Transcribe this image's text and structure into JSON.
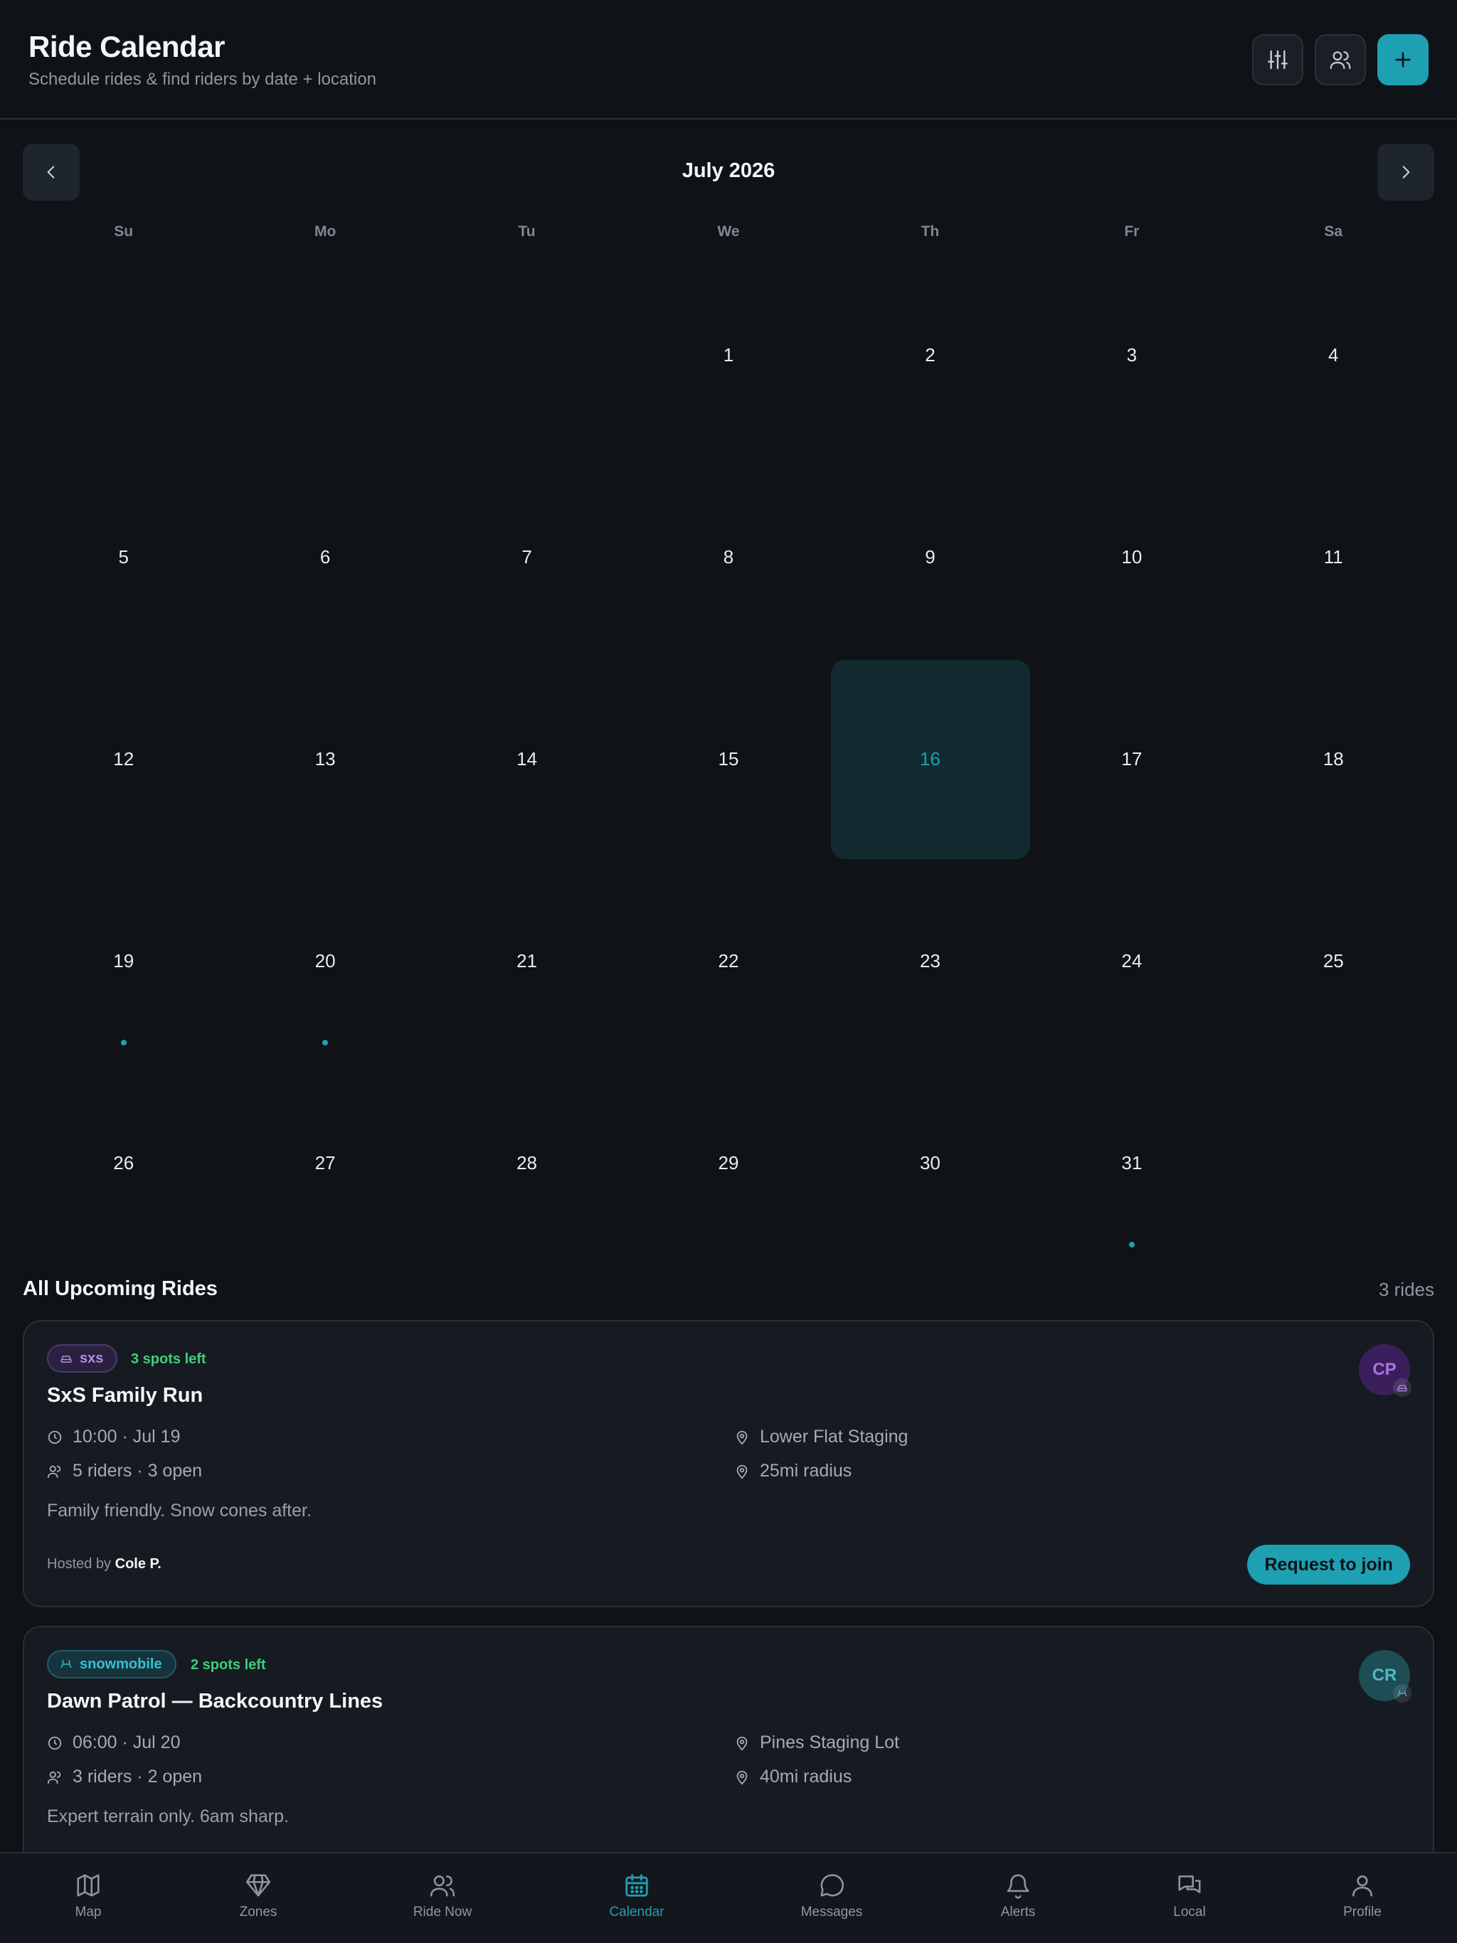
{
  "header": {
    "title": "Ride Calendar",
    "subtitle": "Schedule rides & find riders by date + location",
    "buttons": [
      "sliders-icon",
      "people-icon",
      "plus-icon"
    ]
  },
  "calendar": {
    "month_label": "July 2026",
    "weekdays": [
      "Su",
      "Mo",
      "Tu",
      "We",
      "Th",
      "Fr",
      "Sa"
    ],
    "leading_blanks": 3,
    "days_in_month": 31,
    "today": 16,
    "ride_days": [
      19,
      20,
      31
    ]
  },
  "upcoming": {
    "title": "All Upcoming Rides",
    "count_label": "3 rides",
    "rides": [
      {
        "tag": "sxs",
        "tag_icon": "car-icon",
        "spots": "3 spots left",
        "title": "SxS Family Run",
        "time": "10:00 · Jul 19",
        "riders": "5 riders · 3 open",
        "location": "Lower Flat Staging",
        "radius": "25mi radius",
        "description": "Family friendly. Snow cones after.",
        "host_prefix": "Hosted by",
        "host": "Cole P.",
        "action": "Request to join",
        "avatar": "CP"
      },
      {
        "tag": "snowmobile",
        "tag_icon": "snowmobile-icon",
        "spots": "2 spots left",
        "title": "Dawn Patrol — Backcountry Lines",
        "time": "06:00 · Jul 20",
        "riders": "3 riders · 2 open",
        "location": "Pines Staging Lot",
        "radius": "40mi radius",
        "description": "Expert terrain only. 6am sharp.",
        "avatar": "CR"
      }
    ]
  },
  "tabs": [
    {
      "label": "Map",
      "icon": "map-icon"
    },
    {
      "label": "Zones",
      "icon": "diamond-icon"
    },
    {
      "label": "Ride Now",
      "icon": "users-icon"
    },
    {
      "label": "Calendar",
      "icon": "calendar-icon",
      "active": true
    },
    {
      "label": "Messages",
      "icon": "chat-bubble-icon"
    },
    {
      "label": "Alerts",
      "icon": "bell-icon"
    },
    {
      "label": "Local",
      "icon": "chat-bubbles-icon"
    },
    {
      "label": "Profile",
      "icon": "person-icon"
    }
  ],
  "colors": {
    "background": "#0f1217",
    "accent": "#1ea0b3",
    "spots_green": "#3fcf7c",
    "sxs_purple": "#b58be8"
  }
}
